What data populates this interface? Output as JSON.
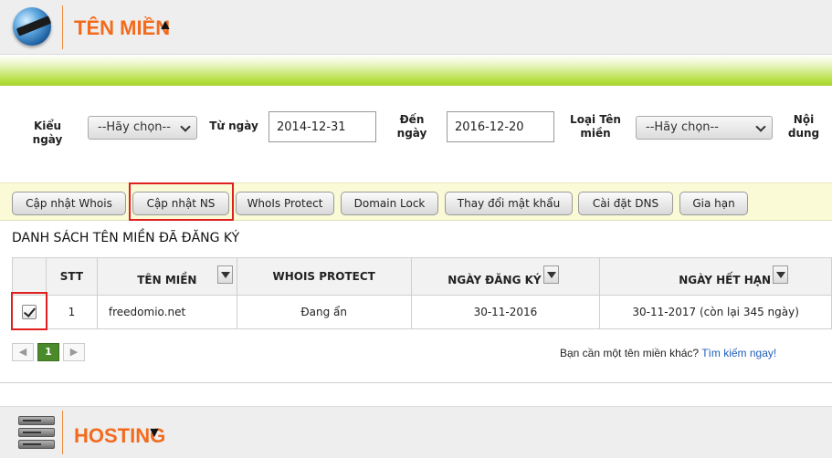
{
  "domains_section": {
    "title": "TÊN MIỀN",
    "toggle_glyph": "▲",
    "icon": "globe-icon"
  },
  "filters": {
    "date_type_label": "Kiểu ngày",
    "date_type_value": "--Hãy chọn--",
    "from_label": "Từ ngày",
    "from_value": "2014-12-31",
    "to_label": "Đến ngày",
    "to_value": "2016-12-20",
    "domain_type_label": "Loại Tên miền",
    "domain_type_value": "--Hãy chọn--",
    "content_label": "Nội dung"
  },
  "actions": {
    "update_whois": "Cập nhật Whois",
    "update_ns": "Cập nhật NS",
    "whois_protect": "WhoIs Protect",
    "domain_lock": "Domain Lock",
    "change_password": "Thay đổi mật khẩu",
    "dns_settings": "Cài đặt DNS",
    "renew": "Gia hạn"
  },
  "list": {
    "title": "DANH SÁCH TÊN MIỀN ĐÃ ĐĂNG KÝ",
    "columns": [
      "STT",
      "TÊN MIỀN",
      "WHOIS PROTECT",
      "NGÀY ĐĂNG KÝ",
      "NGÀY HẾT HẠN"
    ],
    "rows": [
      {
        "checked": true,
        "stt": "1",
        "domain": "freedomio.net",
        "whois": "Đang ẩn",
        "registered": "30-11-2016",
        "expires": "30-11-2017 (còn lại 345 ngày)"
      }
    ]
  },
  "pager": {
    "prev": "◀",
    "current": "1",
    "next": "▶"
  },
  "footer_prompt": {
    "text": "Bạn cần một tên miền khác?",
    "link": "Tìm kiếm ngay!"
  },
  "hosting_section": {
    "title": "HOSTING",
    "toggle_glyph": "▼",
    "icon": "server-icon"
  },
  "colors": {
    "accent": "#f26b1d",
    "highlight": "#e02020",
    "link": "#1e5fb8",
    "pager_active": "#4a8a2a"
  }
}
